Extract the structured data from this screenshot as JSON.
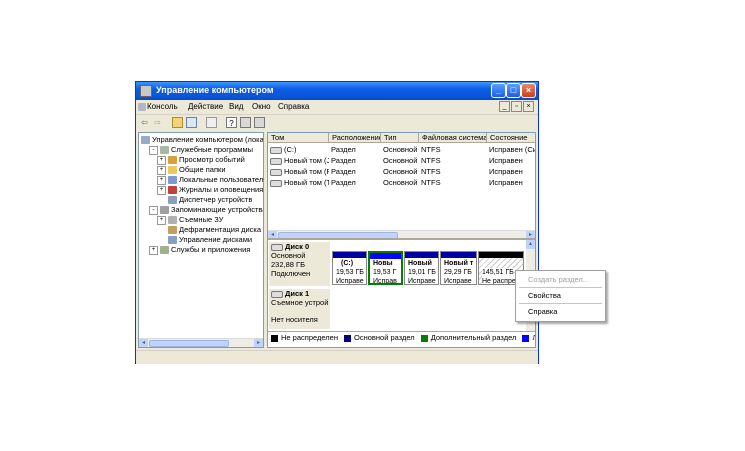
{
  "window": {
    "title": "Управление компьютером"
  },
  "menubar": {
    "items": [
      "Консоль",
      "Действие",
      "Вид",
      "Окно",
      "Справка"
    ]
  },
  "tree": {
    "items": [
      {
        "label": "Управление компьютером (локаль",
        "level": 0,
        "expand": ""
      },
      {
        "label": "Служебные программы",
        "level": 1,
        "expand": "-"
      },
      {
        "label": "Просмотр событий",
        "level": 2,
        "expand": "+"
      },
      {
        "label": "Общие папки",
        "level": 2,
        "expand": "+"
      },
      {
        "label": "Локальные пользователи и",
        "level": 2,
        "expand": "+"
      },
      {
        "label": "Журналы и оповещения пр",
        "level": 2,
        "expand": "+"
      },
      {
        "label": "Диспетчер устройств",
        "level": 2,
        "expand": ""
      },
      {
        "label": "Запоминающие устройства",
        "level": 1,
        "expand": "-"
      },
      {
        "label": "Съемные ЗУ",
        "level": 2,
        "expand": "+"
      },
      {
        "label": "Дефрагментация диска",
        "level": 2,
        "expand": ""
      },
      {
        "label": "Управление дисками",
        "level": 2,
        "expand": ""
      },
      {
        "label": "Службы и приложения",
        "level": 1,
        "expand": "+"
      }
    ]
  },
  "volumes": {
    "headers": [
      "Том",
      "Расположение",
      "Тип",
      "Файловая система",
      "Состояние"
    ],
    "rows": [
      [
        "(C:)",
        "Раздел",
        "Основной",
        "NTFS",
        "Исправен (Си"
      ],
      [
        "Новый том (J:)",
        "Раздел",
        "Основной",
        "NTFS",
        "Исправен"
      ],
      [
        "Новый том (P:)",
        "Раздел",
        "Основной",
        "NTFS",
        "Исправен"
      ],
      [
        "Новый том (T:)",
        "Раздел",
        "Основной",
        "NTFS",
        "Исправен"
      ]
    ]
  },
  "disks": {
    "disk0": {
      "name": "Диск 0",
      "type": "Основной",
      "size": "232,88 ГБ",
      "status": "Подключен"
    },
    "disk1": {
      "name": "Диск 1",
      "type": "Съемное устрой",
      "status": "Нет носителя"
    },
    "partitions": [
      {
        "name": "(C:)",
        "size": "19,53 ГБ",
        "status": "Исправе"
      },
      {
        "name": "Новы",
        "size": "19,53 Г",
        "status": "Исправ"
      },
      {
        "name": "Новый",
        "size": "19,01 ГБ",
        "status": "Исправе"
      },
      {
        "name": "Новый т",
        "size": "29,29 ГБ",
        "status": "Исправе"
      },
      {
        "name": "",
        "size": "145,51 ГБ",
        "status": "Не распреде"
      }
    ]
  },
  "legend": {
    "items": [
      {
        "label": "Не распределен",
        "color": "#000000"
      },
      {
        "label": "Основной раздел",
        "color": "#000080"
      },
      {
        "label": "Дополнительный раздел",
        "color": "#008000"
      },
      {
        "label": "Логичес",
        "color": "#0000ff"
      }
    ]
  },
  "context_menu": {
    "items": [
      {
        "label": "Создать раздел...",
        "disabled": true
      },
      {
        "label": "Свойства",
        "disabled": false
      },
      {
        "label": "Справка",
        "disabled": false
      }
    ]
  },
  "colors": {
    "titlebar": "#0a5ce0",
    "primary_band": "#0000a0",
    "selected_border": "#008000"
  }
}
